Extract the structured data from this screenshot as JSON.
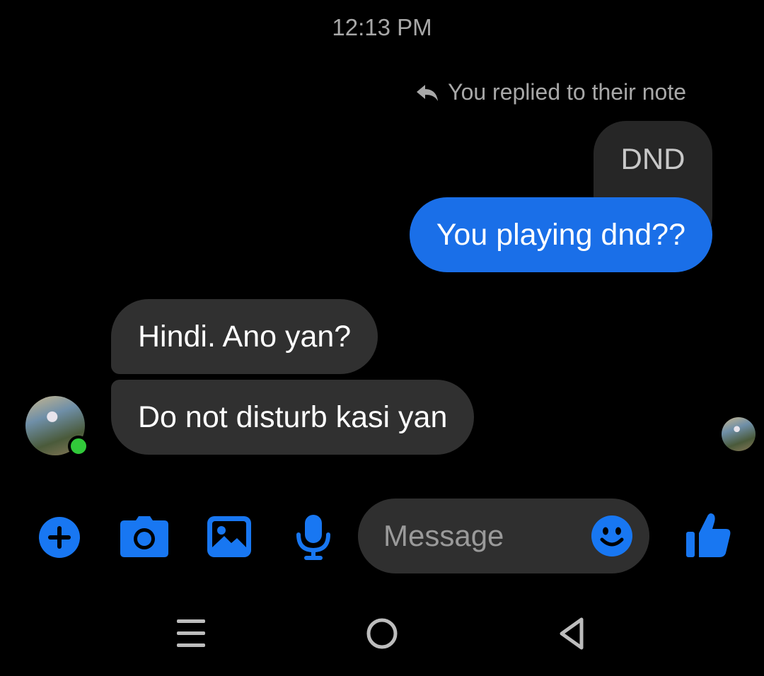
{
  "conversation": {
    "timestamp": "12:13 PM",
    "reply_note_label": "You replied to their note",
    "quoted_note": "DND",
    "messages": [
      {
        "sender": "me",
        "text": "You playing dnd??"
      },
      {
        "sender": "contact",
        "text": "Hindi. Ano yan?"
      },
      {
        "sender": "contact",
        "text": "Do not disturb kasi yan"
      }
    ],
    "contact_status": "online"
  },
  "composer": {
    "placeholder": "Message",
    "icons": [
      "plus-icon",
      "camera-icon",
      "gallery-icon",
      "microphone-icon",
      "emoji-icon",
      "thumbs-up-icon"
    ]
  },
  "navbar": {
    "icons": [
      "recent-apps-icon",
      "home-icon",
      "back-icon"
    ]
  },
  "colors": {
    "background": "#000000",
    "sent_bubble": "#1a6fe8",
    "received_bubble": "#303030",
    "quoted_bubble": "#262626",
    "accent": "#1877f2",
    "online_indicator": "#31c93a",
    "muted_text": "#a8a8a8"
  }
}
